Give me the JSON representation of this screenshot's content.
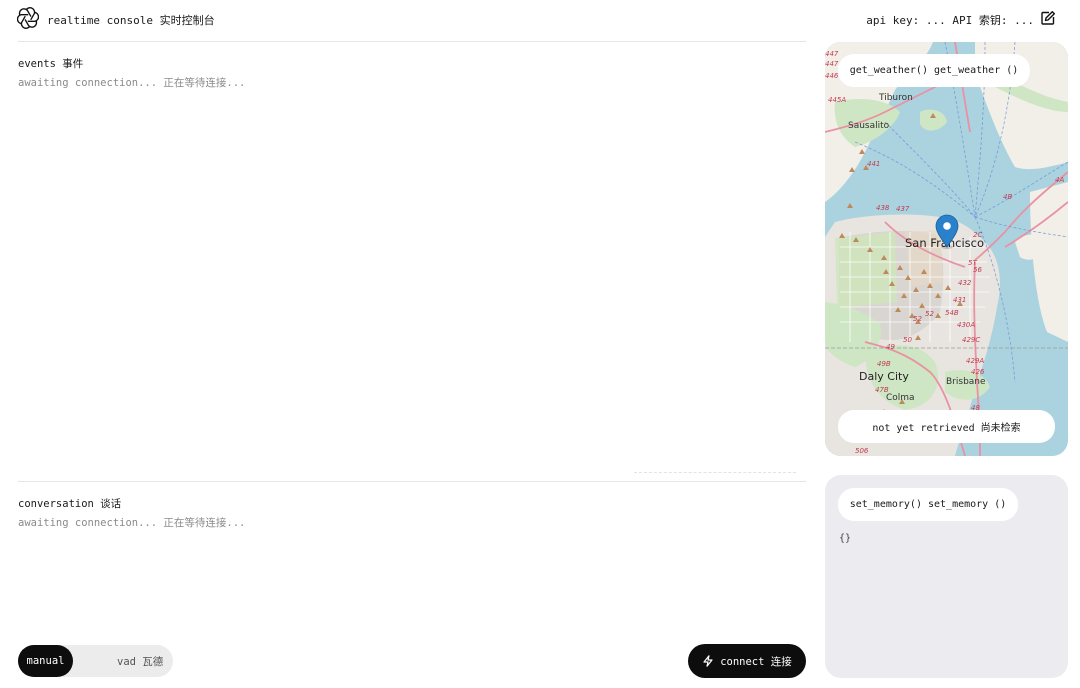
{
  "header": {
    "app_title": "realtime console 实时控制台",
    "api_key_label": "api key: ... API 索钥: ..."
  },
  "events": {
    "title": "events 事件",
    "status": "awaiting connection... 正在等待连接..."
  },
  "conversation": {
    "title": "conversation 谈话",
    "status": "awaiting connection... 正在等待连接..."
  },
  "controls": {
    "mode_manual": "manual",
    "mode_vad": "vad 瓦德",
    "connect_label": "connect 连接"
  },
  "weather": {
    "function_label": "get_weather() get_weather ()",
    "status": "not yet retrieved 尚未检索",
    "map_labels": {
      "tiburon": "Tiburon",
      "sausalito": "Sausalito",
      "san_francisco": "San Francisco",
      "daly_city": "Daly City",
      "brisbane": "Brisbane",
      "colma": "Colma",
      "r447a": "447",
      "r447b": "447",
      "r446": "446",
      "r445a": "445A",
      "r441": "441",
      "r438": "438",
      "r437": "437",
      "r2c": "2C",
      "r4b": "4B",
      "r5": "5",
      "r5t": "5T",
      "r56": "56",
      "r432": "432",
      "r431": "431",
      "r54b": "54B",
      "r52": "52",
      "r52b": "52",
      "r430a": "430A",
      "r429c": "429C",
      "r50": "50",
      "r49": "49",
      "r429a": "429A",
      "r426": "426",
      "r49b": "49B",
      "r47b": "47B",
      "r48": "48",
      "r506": "506",
      "r4a": "4A"
    }
  },
  "memory": {
    "function_label": "set_memory() set_memory ()",
    "value": "{}"
  },
  "colors": {
    "primary_dark": "#0d0d0d",
    "panel_bg": "#ececf0",
    "map_water": "#a9d3df",
    "map_pin": "#2a81cb"
  }
}
